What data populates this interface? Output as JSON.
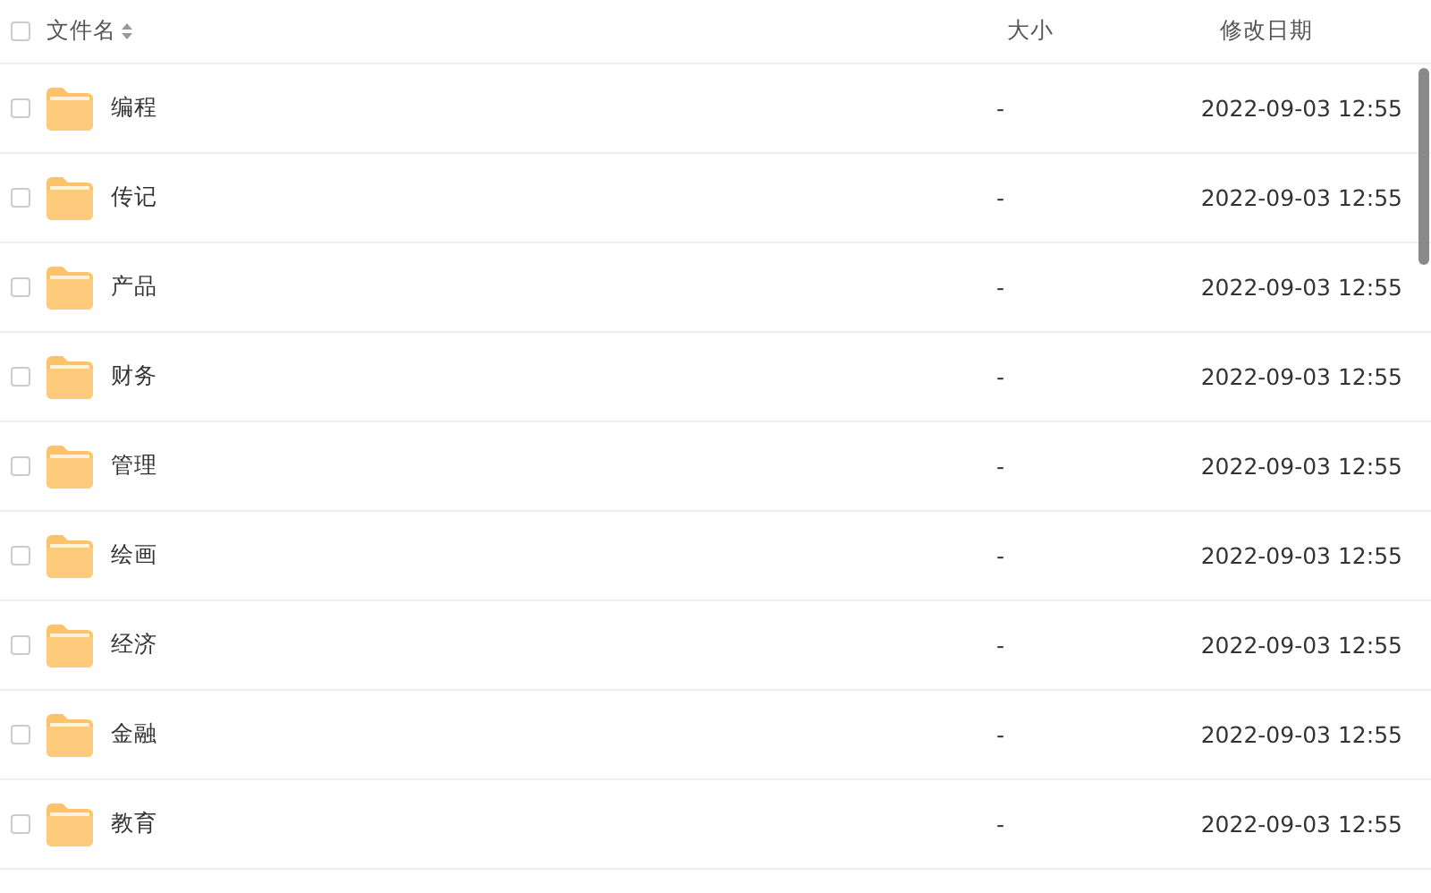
{
  "table": {
    "header_checkbox": {
      "checked": false
    },
    "columns": [
      {
        "label": "文件名",
        "sortable": true
      },
      {
        "label": "大小",
        "sortable": false
      },
      {
        "label": "修改日期",
        "sortable": false
      }
    ],
    "rows": [
      {
        "checked": false,
        "name": "编程",
        "size": "-",
        "modified": "2022-09-03 12:55"
      },
      {
        "checked": false,
        "name": "传记",
        "size": "-",
        "modified": "2022-09-03 12:55"
      },
      {
        "checked": false,
        "name": "产品",
        "size": "-",
        "modified": "2022-09-03 12:55"
      },
      {
        "checked": false,
        "name": "财务",
        "size": "-",
        "modified": "2022-09-03 12:55"
      },
      {
        "checked": false,
        "name": "管理",
        "size": "-",
        "modified": "2022-09-03 12:55"
      },
      {
        "checked": false,
        "name": "绘画",
        "size": "-",
        "modified": "2022-09-03 12:55"
      },
      {
        "checked": false,
        "name": "经济",
        "size": "-",
        "modified": "2022-09-03 12:55"
      },
      {
        "checked": false,
        "name": "金融",
        "size": "-",
        "modified": "2022-09-03 12:55"
      },
      {
        "checked": false,
        "name": "教育",
        "size": "-",
        "modified": "2022-09-03 12:55"
      }
    ]
  }
}
